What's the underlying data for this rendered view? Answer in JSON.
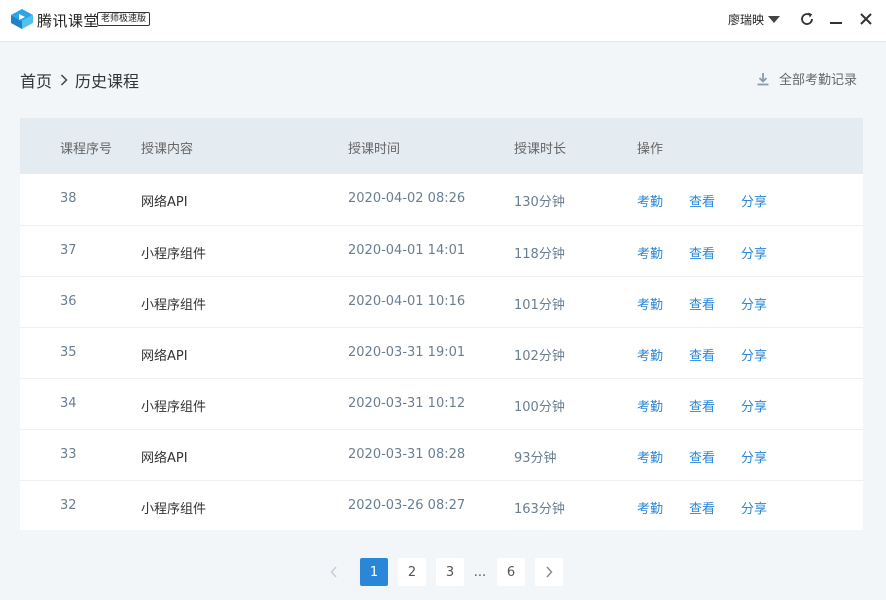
{
  "app": {
    "title": "腾讯课堂",
    "edition": "老师极速版",
    "user_name": "廖瑞映",
    "brand_color": "#2a87d8"
  },
  "breadcrumb": {
    "home": "首页",
    "current": "历史课程"
  },
  "attendance_link": "全部考勤记录",
  "table": {
    "headers": {
      "num": "课程序号",
      "topic": "授课内容",
      "time": "授课时间",
      "duration": "授课时长",
      "ops": "操作"
    },
    "actions": {
      "attendance": "考勤",
      "view": "查看",
      "share": "分享"
    },
    "rows": [
      {
        "num": "38",
        "topic": "网络API",
        "time": "2020-04-02 08:26",
        "duration": "130分钟"
      },
      {
        "num": "37",
        "topic": "小程序组件",
        "time": "2020-04-01 14:01",
        "duration": "118分钟"
      },
      {
        "num": "36",
        "topic": "小程序组件",
        "time": "2020-04-01 10:16",
        "duration": "101分钟"
      },
      {
        "num": "35",
        "topic": "网络API",
        "time": "2020-03-31 19:01",
        "duration": "102分钟"
      },
      {
        "num": "34",
        "topic": "小程序组件",
        "time": "2020-03-31 10:12",
        "duration": "100分钟"
      },
      {
        "num": "33",
        "topic": "网络API",
        "time": "2020-03-31 08:28",
        "duration": "93分钟"
      },
      {
        "num": "32",
        "topic": "小程序组件",
        "time": "2020-03-26 08:27",
        "duration": "163分钟"
      }
    ]
  },
  "pagination": {
    "pages": [
      "1",
      "2",
      "3",
      "6"
    ],
    "current": "1",
    "ellipsis": "..."
  }
}
